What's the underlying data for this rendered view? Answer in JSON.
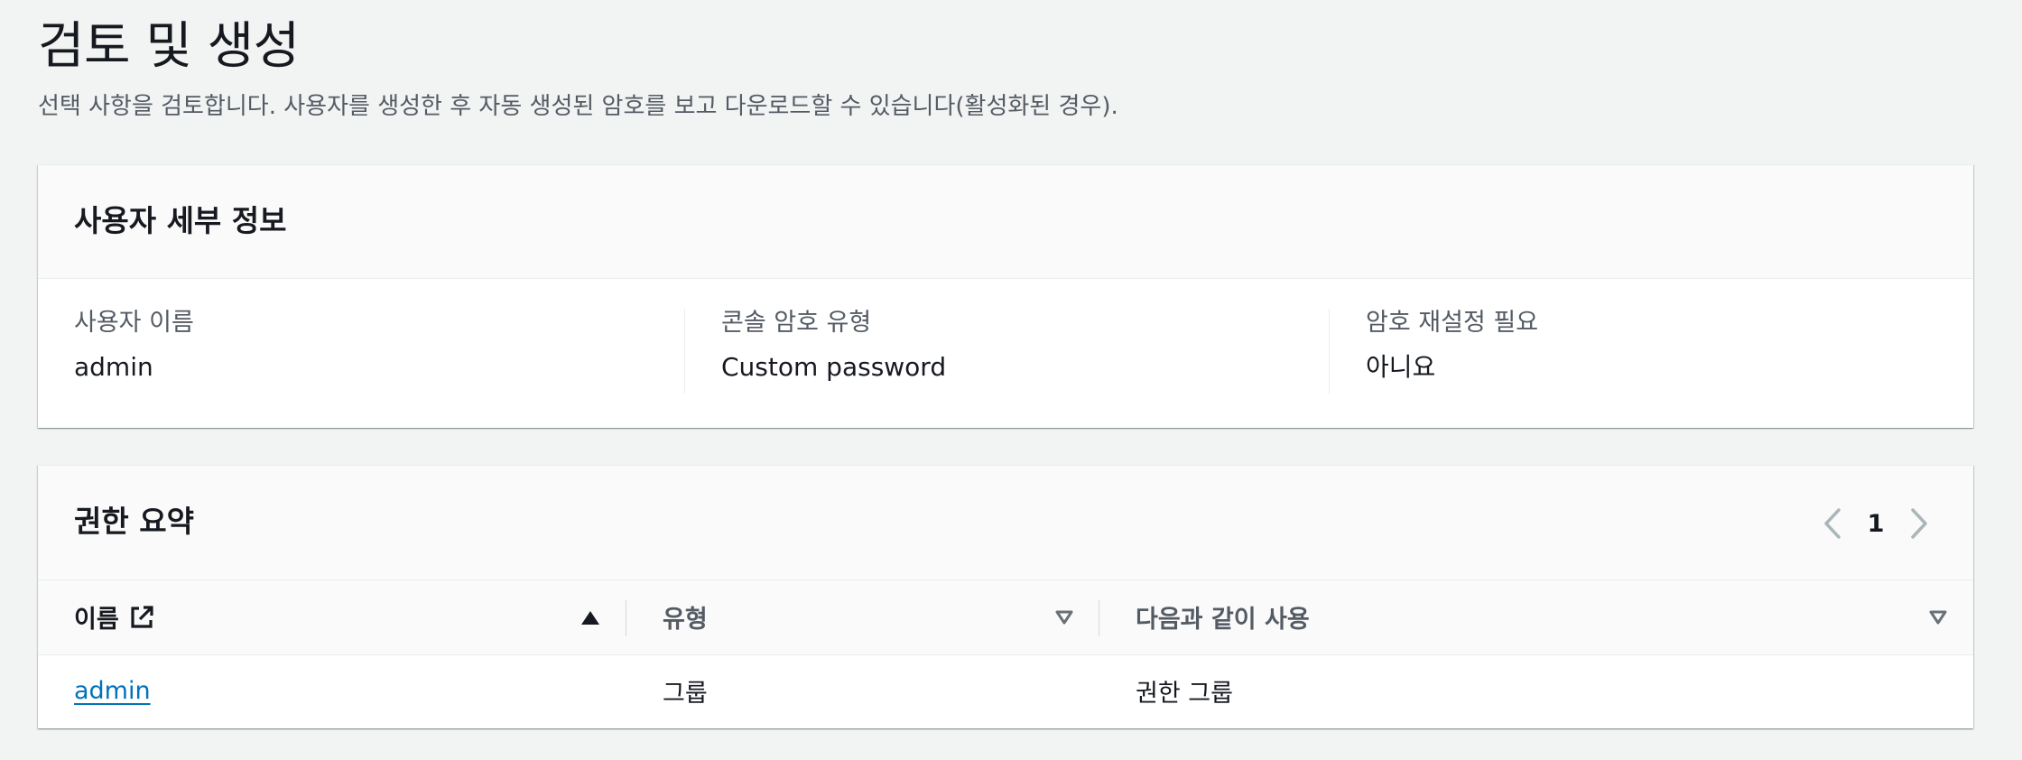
{
  "page": {
    "title": "검토 및 생성",
    "description": "선택 사항을 검토합니다. 사용자를 생성한 후 자동 생성된 암호를 보고 다운로드할 수 있습니다(활성화된 경우)."
  },
  "user_details": {
    "title": "사용자 세부 정보",
    "fields": [
      {
        "label": "사용자 이름",
        "value": "admin"
      },
      {
        "label": "콘솔 암호 유형",
        "value": "Custom password"
      },
      {
        "label": "암호 재설정 필요",
        "value": "아니요"
      }
    ]
  },
  "permissions": {
    "title": "권한 요약",
    "pagination": {
      "current_page": "1"
    },
    "columns": [
      {
        "label": "이름",
        "sort": "ascending"
      },
      {
        "label": "유형",
        "sort": "none"
      },
      {
        "label": "다음과 같이 사용",
        "sort": "none"
      }
    ],
    "rows": [
      {
        "name": "admin",
        "type": "그룹",
        "used_as": "권한 그룹"
      }
    ]
  },
  "colors": {
    "background": "#f2f3f3",
    "link": "#0073bb",
    "text": "#16191f",
    "secondary_text": "#545b64"
  },
  "icons": {
    "external_link": "external-link-icon",
    "sort_ascending": "sort-ascending-icon",
    "sort_none": "sort-none-icon",
    "prev_page": "chevron-left-icon",
    "next_page": "chevron-right-icon"
  }
}
